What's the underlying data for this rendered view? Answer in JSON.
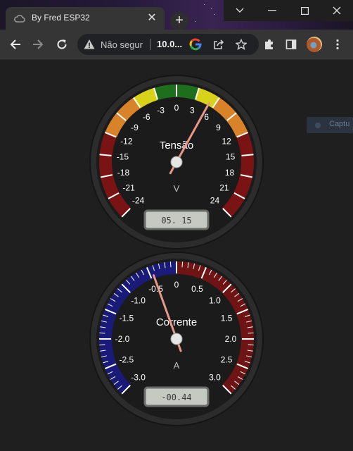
{
  "browser": {
    "tab_title": "By Fred ESP32",
    "tab_close": "✕",
    "new_tab": "+",
    "security_label": "Não segur",
    "url": "10.0..."
  },
  "page": {
    "side_button_label": "Captu"
  },
  "gauges": [
    {
      "title": "Tensão",
      "unit": "V",
      "min": -24,
      "max": 24,
      "major_ticks": [
        "-24",
        "-21",
        "-18",
        "-15",
        "-12",
        "-9",
        "-6",
        "-3",
        "0",
        "3",
        "6",
        "9",
        "12",
        "15",
        "18",
        "21",
        "24"
      ],
      "minor_ticks": 0,
      "value": 5.15,
      "display": "05. 15",
      "highlights": [
        {
          "from": -24,
          "to": -12,
          "color": "#7a1414"
        },
        {
          "from": -12,
          "to": -6,
          "color": "#d8832a"
        },
        {
          "from": -6,
          "to": -3,
          "color": "#d8d21a"
        },
        {
          "from": -3,
          "to": 3,
          "color": "#1e6e1e"
        },
        {
          "from": 3,
          "to": 6,
          "color": "#d8d21a"
        },
        {
          "from": 6,
          "to": 12,
          "color": "#d8832a"
        },
        {
          "from": 12,
          "to": 24,
          "color": "#7a1414"
        }
      ]
    },
    {
      "title": "Corrente",
      "unit": "A",
      "min": -3,
      "max": 3,
      "major_ticks": [
        "-3.0",
        "-2.5",
        "-2.0",
        "-1.5",
        "-1.0",
        "-0.5",
        "0",
        "0.5",
        "1.0",
        "1.5",
        "2.0",
        "2.5",
        "3.0"
      ],
      "minor_ticks": 4,
      "value": -0.44,
      "display": "-00.44",
      "highlights": [
        {
          "from": -3,
          "to": 0,
          "color": "#1a1a78"
        },
        {
          "from": 0,
          "to": 3,
          "color": "#6e1414"
        }
      ]
    }
  ]
}
